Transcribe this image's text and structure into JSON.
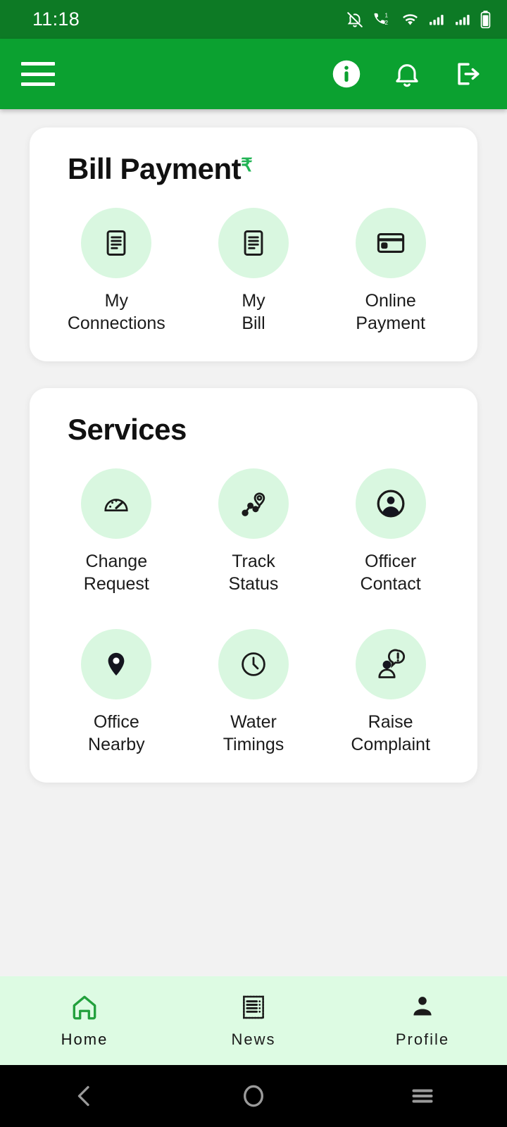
{
  "status_bar": {
    "time": "11:18",
    "icons": [
      "bell-off-icon",
      "dual-sim-call-icon",
      "wifi-icon",
      "signal-1-icon",
      "signal-2-icon",
      "battery-icon"
    ]
  },
  "app_bar": {
    "menu": "menu-icon",
    "actions": [
      "info-icon",
      "notifications-icon",
      "logout-icon"
    ]
  },
  "theme": {
    "status_bar_green": "#0d7a25",
    "app_bar_green": "#0ba130",
    "tile_circle_green": "#d9f7e0",
    "bottom_nav_green": "#ddfbe3",
    "accent_green": "#22b455",
    "page_background": "#f2f2f2"
  },
  "bill_payment": {
    "title": "Bill Payment",
    "currency_symbol": "₹",
    "items": [
      {
        "label": "My\nConnections",
        "icon": "document-icon"
      },
      {
        "label": "My\nBill",
        "icon": "document-icon"
      },
      {
        "label": "Online\nPayment",
        "icon": "credit-card-icon"
      }
    ]
  },
  "services": {
    "title": "Services",
    "items": [
      {
        "label": "Change\nRequest",
        "icon": "speedometer-icon"
      },
      {
        "label": "Track\nStatus",
        "icon": "route-pin-icon"
      },
      {
        "label": "Officer\nContact",
        "icon": "account-circle-icon"
      },
      {
        "label": "Office\nNearby",
        "icon": "location-pin-icon"
      },
      {
        "label": "Water\nTimings",
        "icon": "clock-icon"
      },
      {
        "label": "Raise\nComplaint",
        "icon": "person-alert-icon"
      }
    ]
  },
  "bottom_nav": {
    "items": [
      {
        "label": "Home",
        "icon": "home-icon",
        "active": true
      },
      {
        "label": "News",
        "icon": "newspaper-icon",
        "active": false
      },
      {
        "label": "Profile",
        "icon": "person-icon",
        "active": false
      }
    ]
  },
  "system_nav": {
    "buttons": [
      "back-icon",
      "home-circle-icon",
      "recents-icon"
    ]
  }
}
